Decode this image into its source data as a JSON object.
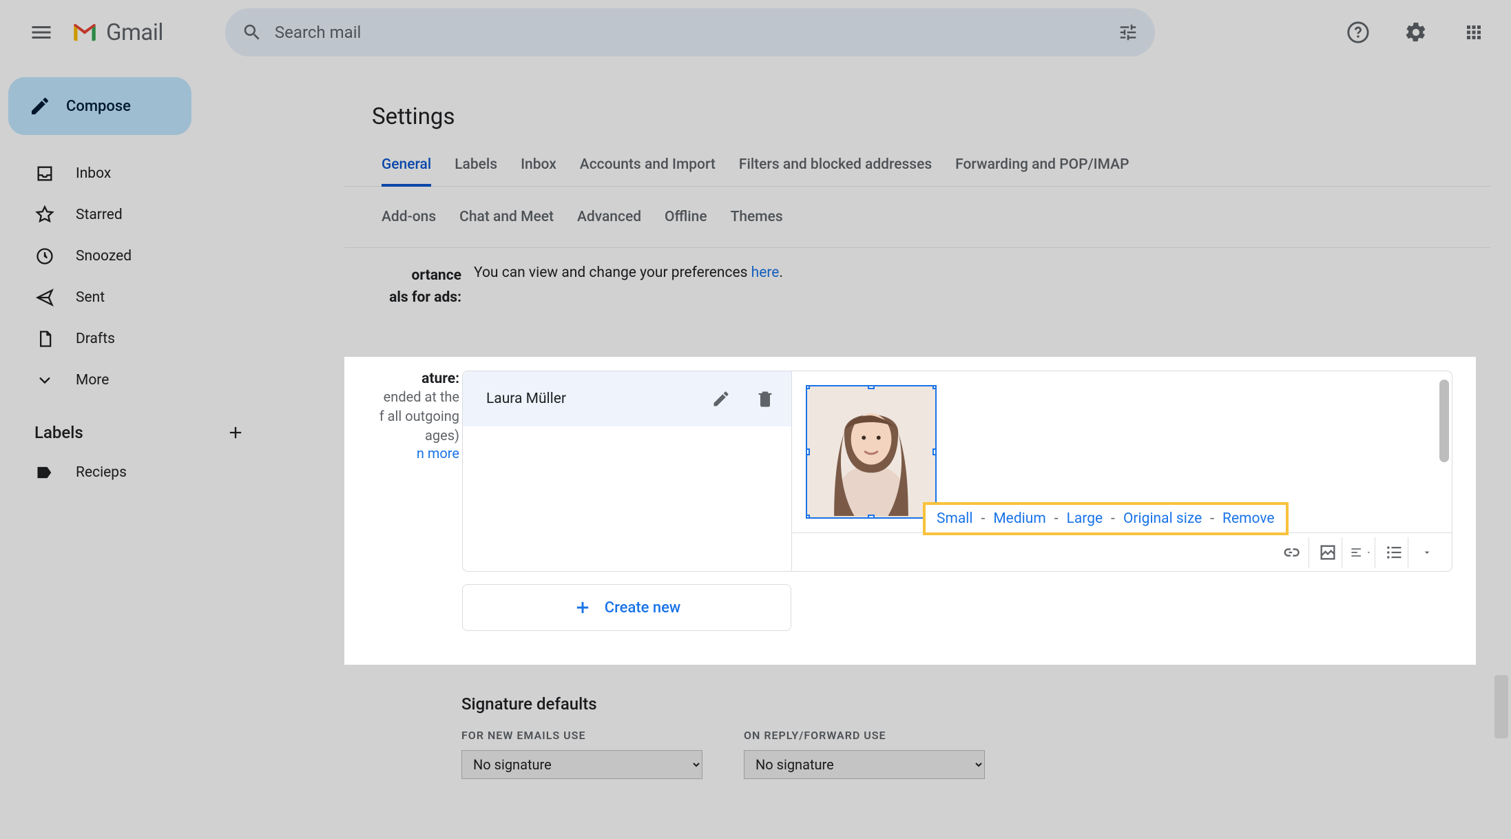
{
  "header": {
    "brand": "Gmail",
    "search_placeholder": "Search mail"
  },
  "sidebar": {
    "compose": "Compose",
    "items": [
      {
        "label": "Inbox"
      },
      {
        "label": "Starred"
      },
      {
        "label": "Snoozed"
      },
      {
        "label": "Sent"
      },
      {
        "label": "Drafts"
      },
      {
        "label": "More"
      }
    ],
    "labels_header": "Labels",
    "labels": [
      {
        "label": "Recieps"
      }
    ]
  },
  "settings": {
    "title": "Settings",
    "tabs_row1": [
      "General",
      "Labels",
      "Inbox",
      "Accounts and Import",
      "Filters and blocked addresses",
      "Forwarding and POP/IMAP"
    ],
    "tabs_row2": [
      "Add-ons",
      "Chat and Meet",
      "Advanced",
      "Offline",
      "Themes"
    ],
    "active_tab": "General",
    "importance": {
      "label_line1": "ortance",
      "label_line2": "als for ads:",
      "desc_prefix": "You can view and change your preferences ",
      "desc_link": "here",
      "desc_suffix": "."
    },
    "signature": {
      "label": "ature:",
      "desc1": "ended at the",
      "desc2": "f all outgoing",
      "desc3": "ages)",
      "learn": "n more",
      "selected_name": "Laura Müller",
      "size_options": [
        "Small",
        "Medium",
        "Large",
        "Original size",
        "Remove"
      ],
      "create_new": "Create new"
    },
    "defaults": {
      "title": "Signature defaults",
      "new_label": "FOR NEW EMAILS USE",
      "reply_label": "ON REPLY/FORWARD USE",
      "new_value": "No signature",
      "reply_value": "No signature"
    }
  }
}
